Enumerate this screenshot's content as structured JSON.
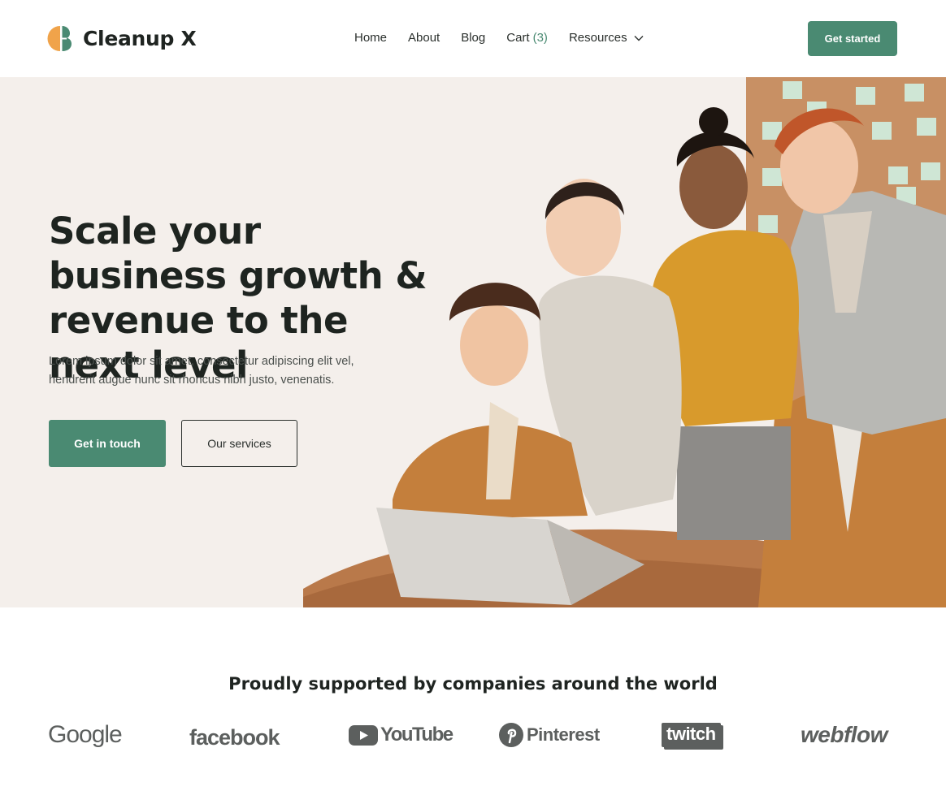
{
  "header": {
    "brand": "Cleanup X",
    "nav": [
      {
        "label": "Home"
      },
      {
        "label": "About"
      },
      {
        "label": "Blog"
      },
      {
        "label": "Cart",
        "count": "(3)"
      },
      {
        "label": "Resources"
      }
    ],
    "cta": "Get started"
  },
  "hero": {
    "title": "Scale your business growth & revenue to the next level",
    "description": "Lorem ipsum dolor sit amet, consectetur adipiscing elit vel, hendrerit augue nunc sit rhoncus nibh justo, venenatis.",
    "primary_button": "Get in touch",
    "secondary_button": "Our services"
  },
  "partners": {
    "title": "Proudly supported by companies around the world",
    "logos": [
      "Google",
      "facebook",
      "YouTube",
      "Pinterest",
      "twitch",
      "webflow"
    ]
  },
  "colors": {
    "accent": "#4a8a72",
    "logo_orange": "#f0a34a",
    "hero_bg": "#f4efeb"
  }
}
